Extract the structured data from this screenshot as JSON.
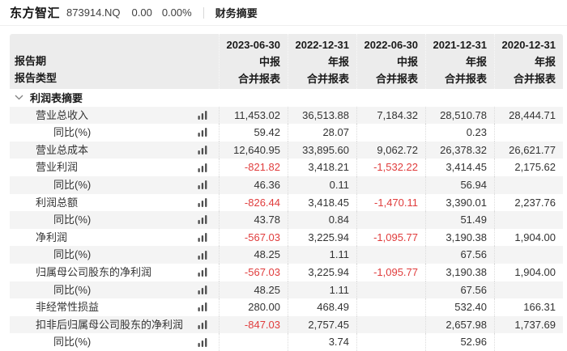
{
  "title_bar": {
    "company": "东方智汇",
    "code": "873914.NQ",
    "price": "0.00",
    "change_pct": "0.00%",
    "tab": "财务摘要"
  },
  "colors": {
    "negative": "#e03c3c",
    "header_bg": "#ececec",
    "row_alt_bg": "#f4f4f4",
    "icon": "#4c4c4c"
  },
  "table": {
    "label_headers": [
      "报告期",
      "报告类型"
    ],
    "columns": [
      {
        "date": "2023-06-30",
        "period": "中报",
        "report_type": "合并报表"
      },
      {
        "date": "2022-12-31",
        "period": "年报",
        "report_type": "合并报表"
      },
      {
        "date": "2022-06-30",
        "period": "中报",
        "report_type": "合并报表"
      },
      {
        "date": "2021-12-31",
        "period": "年报",
        "report_type": "合并报表"
      },
      {
        "date": "2020-12-31",
        "period": "年报",
        "report_type": "合并报表"
      }
    ],
    "section_title": "利润表摘要",
    "rows": [
      {
        "label": "营业总收入",
        "indent": 1,
        "values": [
          "11,453.02",
          "36,513.88",
          "7,184.32",
          "28,510.78",
          "28,444.71"
        ]
      },
      {
        "label": "同比(%)",
        "indent": 2,
        "values": [
          "59.42",
          "28.07",
          "",
          "0.23",
          ""
        ]
      },
      {
        "label": "营业总成本",
        "indent": 1,
        "values": [
          "12,640.95",
          "33,895.60",
          "9,062.72",
          "26,378.32",
          "26,621.77"
        ]
      },
      {
        "label": "营业利润",
        "indent": 1,
        "values": [
          "-821.82",
          "3,418.21",
          "-1,532.22",
          "3,414.45",
          "2,175.62"
        ]
      },
      {
        "label": "同比(%)",
        "indent": 2,
        "values": [
          "46.36",
          "0.11",
          "",
          "56.94",
          ""
        ]
      },
      {
        "label": "利润总额",
        "indent": 1,
        "values": [
          "-826.44",
          "3,418.45",
          "-1,470.11",
          "3,390.01",
          "2,237.76"
        ]
      },
      {
        "label": "同比(%)",
        "indent": 2,
        "values": [
          "43.78",
          "0.84",
          "",
          "51.49",
          ""
        ]
      },
      {
        "label": "净利润",
        "indent": 1,
        "values": [
          "-567.03",
          "3,225.94",
          "-1,095.77",
          "3,190.38",
          "1,904.00"
        ]
      },
      {
        "label": "同比(%)",
        "indent": 2,
        "values": [
          "48.25",
          "1.11",
          "",
          "67.56",
          ""
        ]
      },
      {
        "label": "归属母公司股东的净利润",
        "indent": 1,
        "values": [
          "-567.03",
          "3,225.94",
          "-1,095.77",
          "3,190.38",
          "1,904.00"
        ]
      },
      {
        "label": "同比(%)",
        "indent": 2,
        "values": [
          "48.25",
          "1.11",
          "",
          "67.56",
          ""
        ]
      },
      {
        "label": "非经常性损益",
        "indent": 1,
        "values": [
          "280.00",
          "468.49",
          "",
          "532.40",
          "166.31"
        ]
      },
      {
        "label": "扣非后归属母公司股东的净利润",
        "indent": 1,
        "values": [
          "-847.03",
          "2,757.45",
          "",
          "2,657.98",
          "1,737.69"
        ]
      },
      {
        "label": "同比(%)",
        "indent": 2,
        "values": [
          "",
          "3.74",
          "",
          "52.96",
          ""
        ]
      }
    ]
  }
}
